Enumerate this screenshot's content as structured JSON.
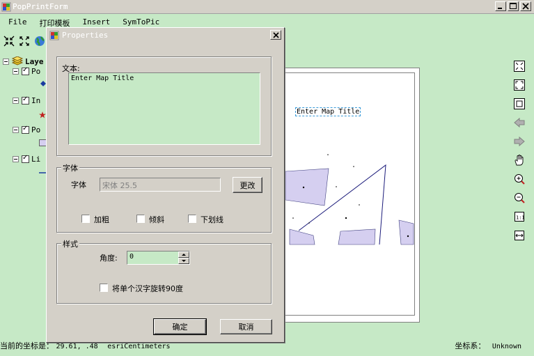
{
  "window": {
    "title": "PopPrintForm"
  },
  "menu": [
    "File",
    "打印模板",
    "Insert",
    "SymToPic"
  ],
  "toc": {
    "root_label": "Laye",
    "layers": [
      {
        "label": "Po",
        "checked": true
      },
      {
        "label": "In",
        "checked": true
      },
      {
        "label": "Po",
        "checked": true
      },
      {
        "label": "Li",
        "checked": true
      }
    ]
  },
  "layout": {
    "map_title": "Enter Map Title"
  },
  "status": {
    "coord_label": "当前的坐标是：",
    "coord_value": "29.61, .48",
    "units": "esriCentimeters",
    "crs_label": "坐标系：",
    "crs_value": "Unknown"
  },
  "dialog": {
    "title": "Properties",
    "text_label": "文本:",
    "text_value": "Enter Map Title",
    "font_group": "字体",
    "font_label": "字体",
    "font_value": "宋体  25.5",
    "change_button": "更改",
    "bold_label": "加粗",
    "italic_label": "倾斜",
    "underline_label": "下划线",
    "style_group": "样式",
    "angle_label": "角度:",
    "angle_value": "0",
    "rotate_label": "将单个汉字旋转90度",
    "ok_button": "确定",
    "cancel_button": "取消"
  },
  "colors": {
    "background_green": "#c6e9c6",
    "chrome_gray": "#d4d0c8",
    "polygon_fill": "#d5cff0",
    "line_navy": "#1a1a7a"
  }
}
